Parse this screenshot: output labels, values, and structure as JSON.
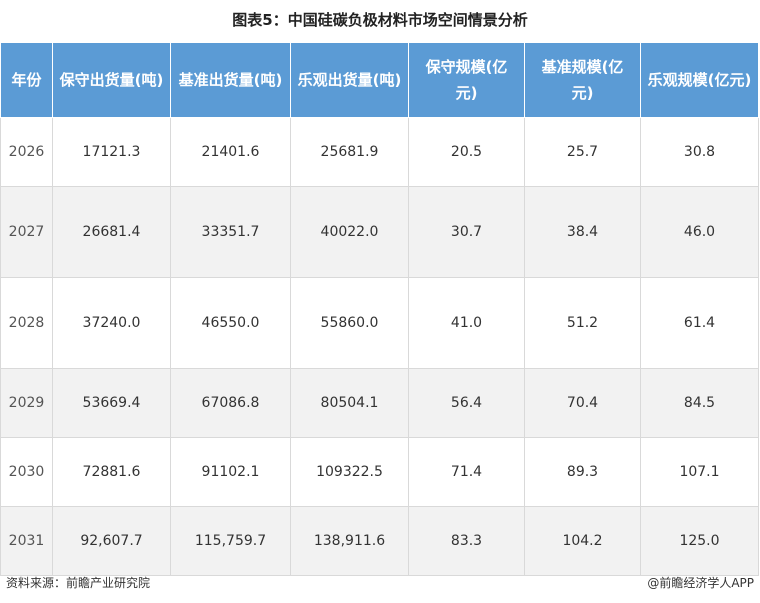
{
  "title": "图表5：中国硅碳负极材料市场空间情景分析",
  "table": {
    "headers": [
      "年份",
      "保守出货量(吨)",
      "基准出货量(吨)",
      "乐观出货量(吨)",
      "保守规模(亿元)",
      "基准规模(亿元)",
      "乐观规模(亿元)"
    ],
    "rows": [
      [
        "2026",
        "17121.3",
        "21401.6",
        "25681.9",
        "20.5",
        "25.7",
        "30.8"
      ],
      [
        "2027",
        "26681.4",
        "33351.7",
        "40022.0",
        "30.7",
        "38.4",
        "46.0"
      ],
      [
        "2028",
        "37240.0",
        "46550.0",
        "55860.0",
        "41.0",
        "51.2",
        "61.4"
      ],
      [
        "2029",
        "53669.4",
        "67086.8",
        "80504.1",
        "56.4",
        "70.4",
        "84.5"
      ],
      [
        "2030",
        "72881.6",
        "91102.1",
        "109322.5",
        "71.4",
        "89.3",
        "107.1"
      ],
      [
        "2031",
        "92,607.7",
        "115,759.7",
        "138,911.6",
        "83.3",
        "104.2",
        "125.0"
      ]
    ]
  },
  "footer": {
    "source": "资料来源：前瞻产业研究院",
    "brand": "@前瞻经济学人APP"
  },
  "colors": {
    "header_bg": "#5b9bd5",
    "row_alt_bg": "#f2f2f2"
  }
}
